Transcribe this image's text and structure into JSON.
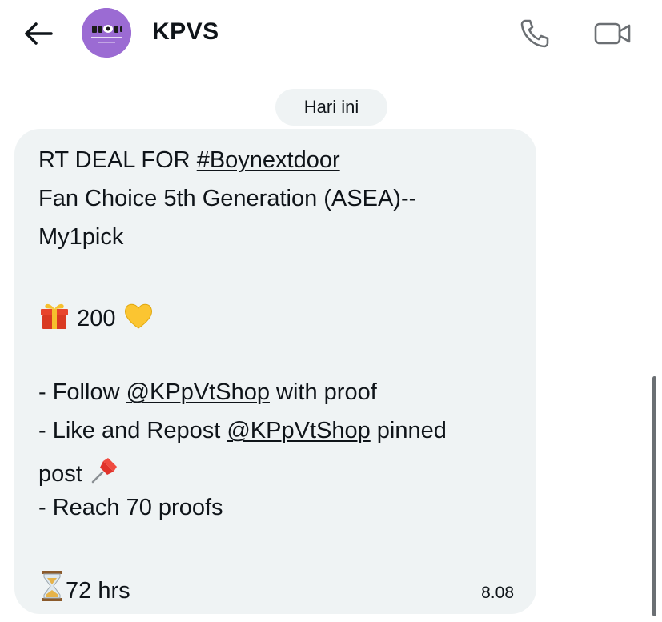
{
  "header": {
    "title": "KPVS",
    "avatar_text": "KPOP VOTING SHOP"
  },
  "date_chip": "Hari ini",
  "message": {
    "line1_pre": "RT DEAL FOR ",
    "line1_tag": "#Boynextdoor",
    "line2": "Fan Choice 5th Generation (ASEA)--",
    "line3": "My1pick",
    "reward_amount": "200",
    "follow_pre": "- Follow ",
    "follow_handle": "@KPpVtShop",
    "follow_post": " with proof",
    "like_pre": "- Like and Repost ",
    "like_handle": "@KPpVtShop",
    "like_post": " pinned",
    "post_word": "post",
    "reach": "- Reach 70 proofs",
    "duration": "72 hrs",
    "time": "8.08"
  },
  "icons": {
    "back": "arrow-left-icon",
    "call": "phone-icon",
    "video": "video-camera-icon",
    "gift": "gift-emoji-icon",
    "heart": "yellow-heart-emoji-icon",
    "pin": "pushpin-emoji-icon",
    "hourglass": "hourglass-emoji-icon"
  },
  "colors": {
    "bubble": "#eff3f4",
    "avatar": "#9b6bd3",
    "text": "#0f1419"
  }
}
